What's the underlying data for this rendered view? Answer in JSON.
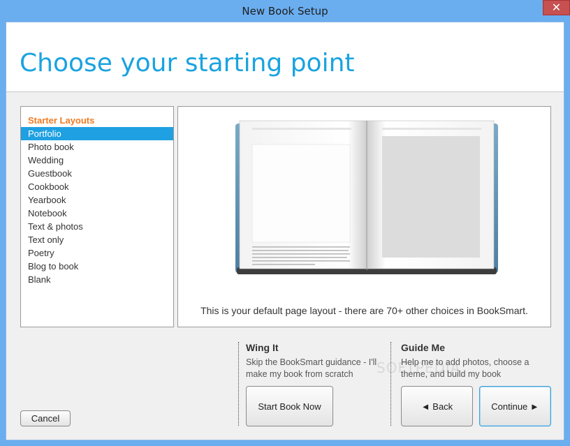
{
  "window": {
    "title": "New Book Setup",
    "close_glyph": "✕"
  },
  "header": {
    "title": "Choose your starting point"
  },
  "layouts": {
    "heading": "Starter Layouts",
    "items": [
      "Portfolio",
      "Photo book",
      "Wedding",
      "Guestbook",
      "Cookbook",
      "Yearbook",
      "Notebook",
      "Text & photos",
      "Text only",
      "Poetry",
      "Blog to book",
      "Blank"
    ],
    "selected": "Portfolio"
  },
  "preview": {
    "caption": "This is your default page layout - there are 70+ other choices in BookSmart."
  },
  "wing_it": {
    "title": "Wing It",
    "desc_line1": "Skip the BookSmart guidance - I'll",
    "desc_line2": "make my book from scratch",
    "button": "Start Book Now"
  },
  "guide_me": {
    "title": "Guide Me",
    "desc_line1": "Help me to add photos, choose a",
    "desc_line2": "theme, and build my book",
    "back_button": "◄ Back",
    "continue_button": "Continue ►"
  },
  "cancel_button": "Cancel",
  "watermark": "SOFTPEDIA",
  "colors": {
    "accent": "#1aa3e0",
    "section_heading": "#f07a22",
    "selection": "#1ea0e2",
    "titlebar": "#6aaef0",
    "close": "#c75050"
  }
}
